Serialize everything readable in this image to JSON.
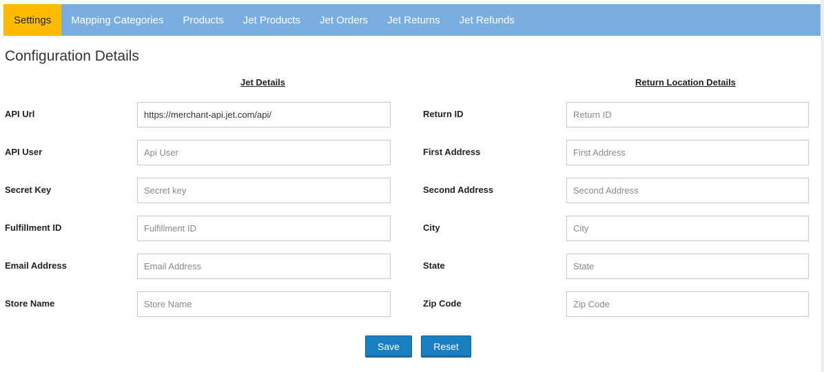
{
  "nav": {
    "items": [
      {
        "label": "Settings",
        "active": true
      },
      {
        "label": "Mapping Categories",
        "active": false
      },
      {
        "label": "Products",
        "active": false
      },
      {
        "label": "Jet Products",
        "active": false
      },
      {
        "label": "Jet Orders",
        "active": false
      },
      {
        "label": "Jet Returns",
        "active": false
      },
      {
        "label": "Jet Refunds",
        "active": false
      }
    ]
  },
  "colors": {
    "navbar": "#7aaee0",
    "active_tab": "#ffbb00",
    "button": "#1a7fc0"
  },
  "page": {
    "title": "Configuration Details"
  },
  "jet_details": {
    "title": "Jet Details",
    "fields": [
      {
        "label": "API Url",
        "value": "https://merchant-api.jet.com/api/",
        "placeholder": "API Url"
      },
      {
        "label": "API User",
        "value": "",
        "placeholder": "Api User"
      },
      {
        "label": "Secret Key",
        "value": "",
        "placeholder": "Secret key"
      },
      {
        "label": "Fulfillment ID",
        "value": "",
        "placeholder": "Fulfillment ID"
      },
      {
        "label": "Email Address",
        "value": "",
        "placeholder": "Email Address"
      },
      {
        "label": "Store Name",
        "value": "",
        "placeholder": "Store Name"
      }
    ]
  },
  "return_location": {
    "title": "Return Location Details",
    "fields": [
      {
        "label": "Return ID",
        "value": "",
        "placeholder": "Return ID"
      },
      {
        "label": "First Address",
        "value": "",
        "placeholder": "First Address"
      },
      {
        "label": "Second Address",
        "value": "",
        "placeholder": "Second Address"
      },
      {
        "label": "City",
        "value": "",
        "placeholder": "City"
      },
      {
        "label": "State",
        "value": "",
        "placeholder": "State"
      },
      {
        "label": "Zip Code",
        "value": "",
        "placeholder": "Zip Code"
      }
    ]
  },
  "actions": {
    "save_label": "Save",
    "reset_label": "Reset"
  }
}
